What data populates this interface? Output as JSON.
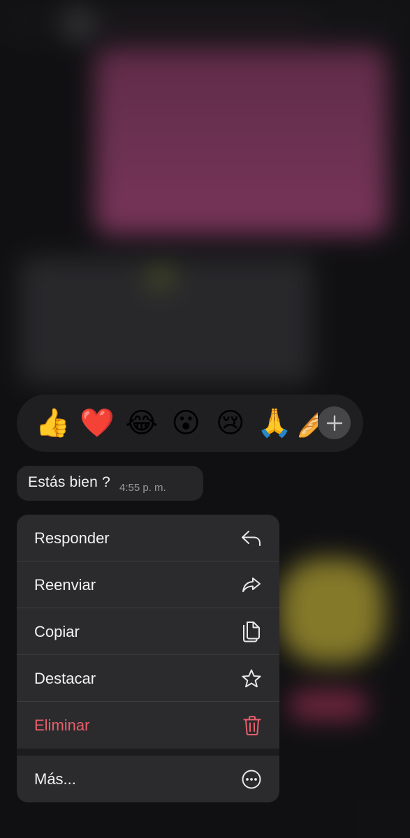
{
  "reactions": {
    "emojis": [
      "👍",
      "❤️",
      "😂",
      "😮",
      "😢",
      "🙏",
      "🥖"
    ],
    "more_label": "+"
  },
  "message": {
    "text": "Estás bien ?",
    "time": "4:55 p. m."
  },
  "context_menu": {
    "items": [
      {
        "label": "Responder",
        "icon": "reply-icon"
      },
      {
        "label": "Reenviar",
        "icon": "forward-icon"
      },
      {
        "label": "Copiar",
        "icon": "copy-icon"
      },
      {
        "label": "Destacar",
        "icon": "star-icon"
      },
      {
        "label": "Eliminar",
        "icon": "trash-icon",
        "destructive": true
      },
      {
        "label": "Más...",
        "icon": "more-icon"
      }
    ]
  },
  "colors": {
    "menu_background": "#2b2b2d",
    "destructive": "#e65f6b",
    "text": "#f2f2f2",
    "timestamp": "#9a9a9e"
  }
}
